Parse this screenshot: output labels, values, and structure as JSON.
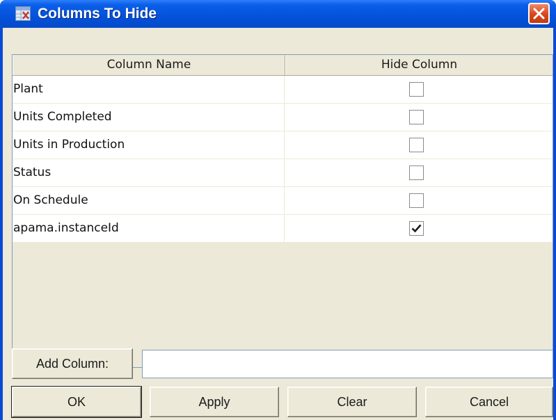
{
  "window": {
    "title": "Columns To Hide",
    "icon": "table-app-icon",
    "close_icon": "close-icon"
  },
  "table": {
    "headers": [
      "Column Name",
      "Hide Column"
    ],
    "rows": [
      {
        "name": "Plant",
        "hidden": false
      },
      {
        "name": "Units Completed",
        "hidden": false
      },
      {
        "name": "Units in Production",
        "hidden": false
      },
      {
        "name": "Status",
        "hidden": false
      },
      {
        "name": "On Schedule",
        "hidden": false
      },
      {
        "name": "apama.instanceId",
        "hidden": true
      }
    ]
  },
  "add_column": {
    "button_label": "Add Column:",
    "input_value": ""
  },
  "buttons": {
    "ok": "OK",
    "apply": "Apply",
    "clear": "Clear",
    "cancel": "Cancel"
  },
  "colors": {
    "titlebar": "#0453dc",
    "close_button": "#d9451a",
    "dialog_background": "#ece9d8"
  }
}
